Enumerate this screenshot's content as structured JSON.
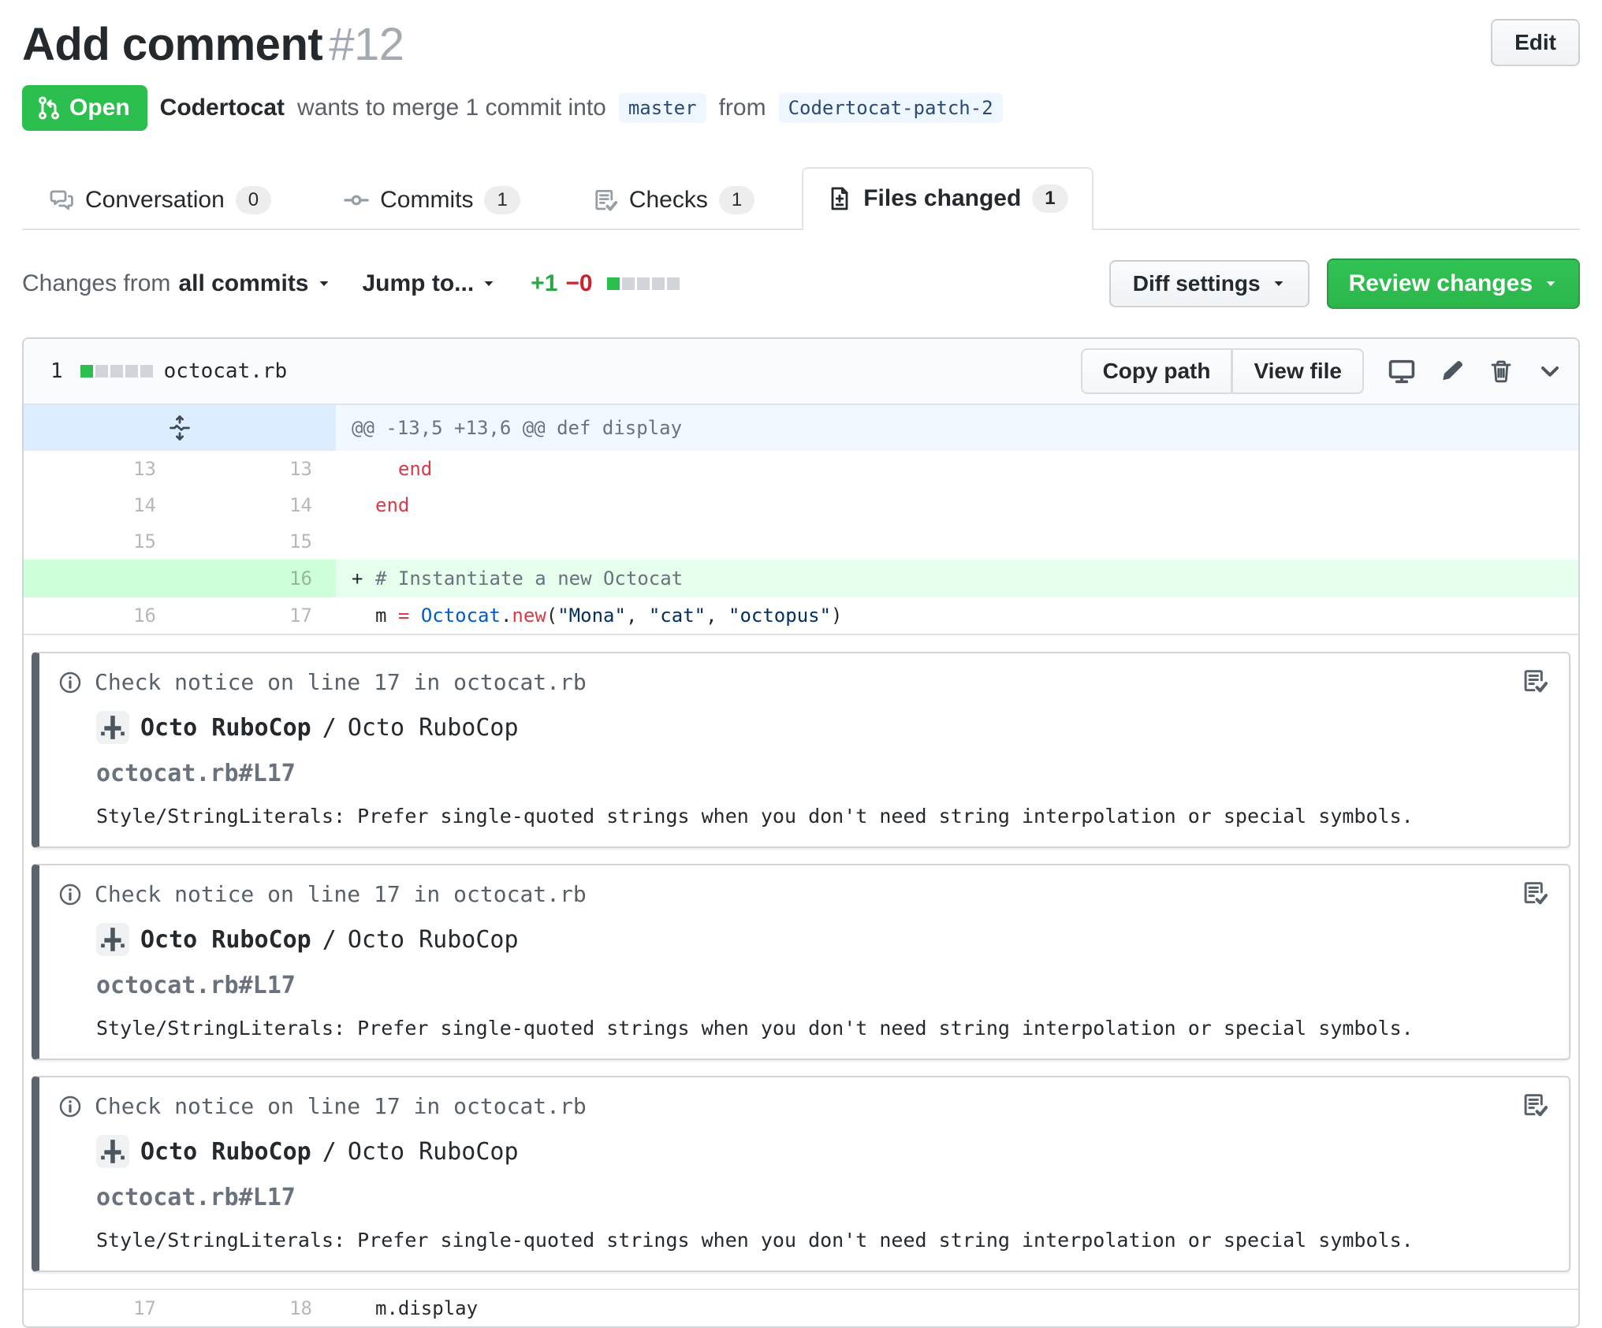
{
  "header": {
    "title": "Add comment",
    "number": "#12",
    "edit_label": "Edit",
    "state_label": "Open",
    "author": "Codertocat",
    "byline_mid": "wants to merge 1 commit into",
    "base_branch": "master",
    "from_word": "from",
    "head_branch": "Codertocat-patch-2"
  },
  "tabs": [
    {
      "id": "conversation",
      "label": "Conversation",
      "count": "0",
      "icon": "comment-discussion-icon",
      "active": false
    },
    {
      "id": "commits",
      "label": "Commits",
      "count": "1",
      "icon": "commit-icon",
      "active": false
    },
    {
      "id": "checks",
      "label": "Checks",
      "count": "1",
      "icon": "checks-icon",
      "active": false
    },
    {
      "id": "files-changed",
      "label": "Files changed",
      "count": "1",
      "icon": "file-diff-icon",
      "active": true
    }
  ],
  "toolbar": {
    "changes_from_label": "Changes from",
    "all_commits_label": "all commits",
    "jump_to_label": "Jump to...",
    "additions": "+1",
    "deletions": "−0",
    "diffstat": [
      "added",
      "neutral",
      "neutral",
      "neutral",
      "neutral"
    ],
    "diff_settings_label": "Diff settings",
    "review_changes_label": "Review changes"
  },
  "file": {
    "changed_count": "1",
    "diffstat": [
      "added",
      "neutral",
      "neutral",
      "neutral",
      "neutral"
    ],
    "name": "octocat.rb",
    "copy_path_label": "Copy path",
    "view_file_label": "View file"
  },
  "diff": {
    "rows": [
      {
        "type": "hunk",
        "text": "@@ -13,5 +13,6 @@ def display"
      },
      {
        "type": "context",
        "old": "13",
        "new": "13",
        "marker": " ",
        "code": [
          {
            "t": "  ",
            "c": "pln"
          },
          {
            "t": "end",
            "c": "kw"
          }
        ]
      },
      {
        "type": "context",
        "old": "14",
        "new": "14",
        "marker": " ",
        "code": [
          {
            "t": "end",
            "c": "kw"
          }
        ]
      },
      {
        "type": "context",
        "old": "15",
        "new": "15",
        "marker": " ",
        "code": []
      },
      {
        "type": "add",
        "old": "",
        "new": "16",
        "marker": "+",
        "code": [
          {
            "t": "# Instantiate a new Octocat",
            "c": "com"
          }
        ]
      },
      {
        "type": "context",
        "old": "16",
        "new": "17",
        "marker": " ",
        "code": [
          {
            "t": "m ",
            "c": "pln"
          },
          {
            "t": "=",
            "c": "kw"
          },
          {
            "t": " ",
            "c": "pln"
          },
          {
            "t": "Octocat",
            "c": "const"
          },
          {
            "t": ".",
            "c": "pln"
          },
          {
            "t": "new",
            "c": "kw"
          },
          {
            "t": "(",
            "c": "pln"
          },
          {
            "t": "\"Mona\"",
            "c": "str"
          },
          {
            "t": ", ",
            "c": "pln"
          },
          {
            "t": "\"cat\"",
            "c": "str"
          },
          {
            "t": ", ",
            "c": "pln"
          },
          {
            "t": "\"octopus\"",
            "c": "str"
          },
          {
            "t": ")",
            "c": "pln"
          }
        ]
      },
      {
        "type": "annotations"
      },
      {
        "type": "context",
        "old": "17",
        "new": "18",
        "marker": " ",
        "code": [
          {
            "t": "m.display",
            "c": "pln"
          }
        ]
      }
    ]
  },
  "annotations": [
    {
      "header": "Check notice on line 17 in octocat.rb",
      "app_name": "Octo RuboCop",
      "separator": "/",
      "context": "Octo RuboCop",
      "path": "octocat.rb#L17",
      "message": "Style/StringLiterals: Prefer single-quoted strings when you don't need string interpolation or special symbols."
    },
    {
      "header": "Check notice on line 17 in octocat.rb",
      "app_name": "Octo RuboCop",
      "separator": "/",
      "context": "Octo RuboCop",
      "path": "octocat.rb#L17",
      "message": "Style/StringLiterals: Prefer single-quoted strings when you don't need string interpolation or special symbols."
    },
    {
      "header": "Check notice on line 17 in octocat.rb",
      "app_name": "Octo RuboCop",
      "separator": "/",
      "context": "Octo RuboCop",
      "path": "octocat.rb#L17",
      "message": "Style/StringLiterals: Prefer single-quoted strings when you don't need string interpolation or special symbols."
    }
  ],
  "colors": {
    "open_green": "#2cbe4e",
    "addition_green": "#28a745",
    "deletion_red": "#cb2431",
    "add_line_bg": "#e6ffed",
    "hunk_bg": "#f1f8ff"
  }
}
